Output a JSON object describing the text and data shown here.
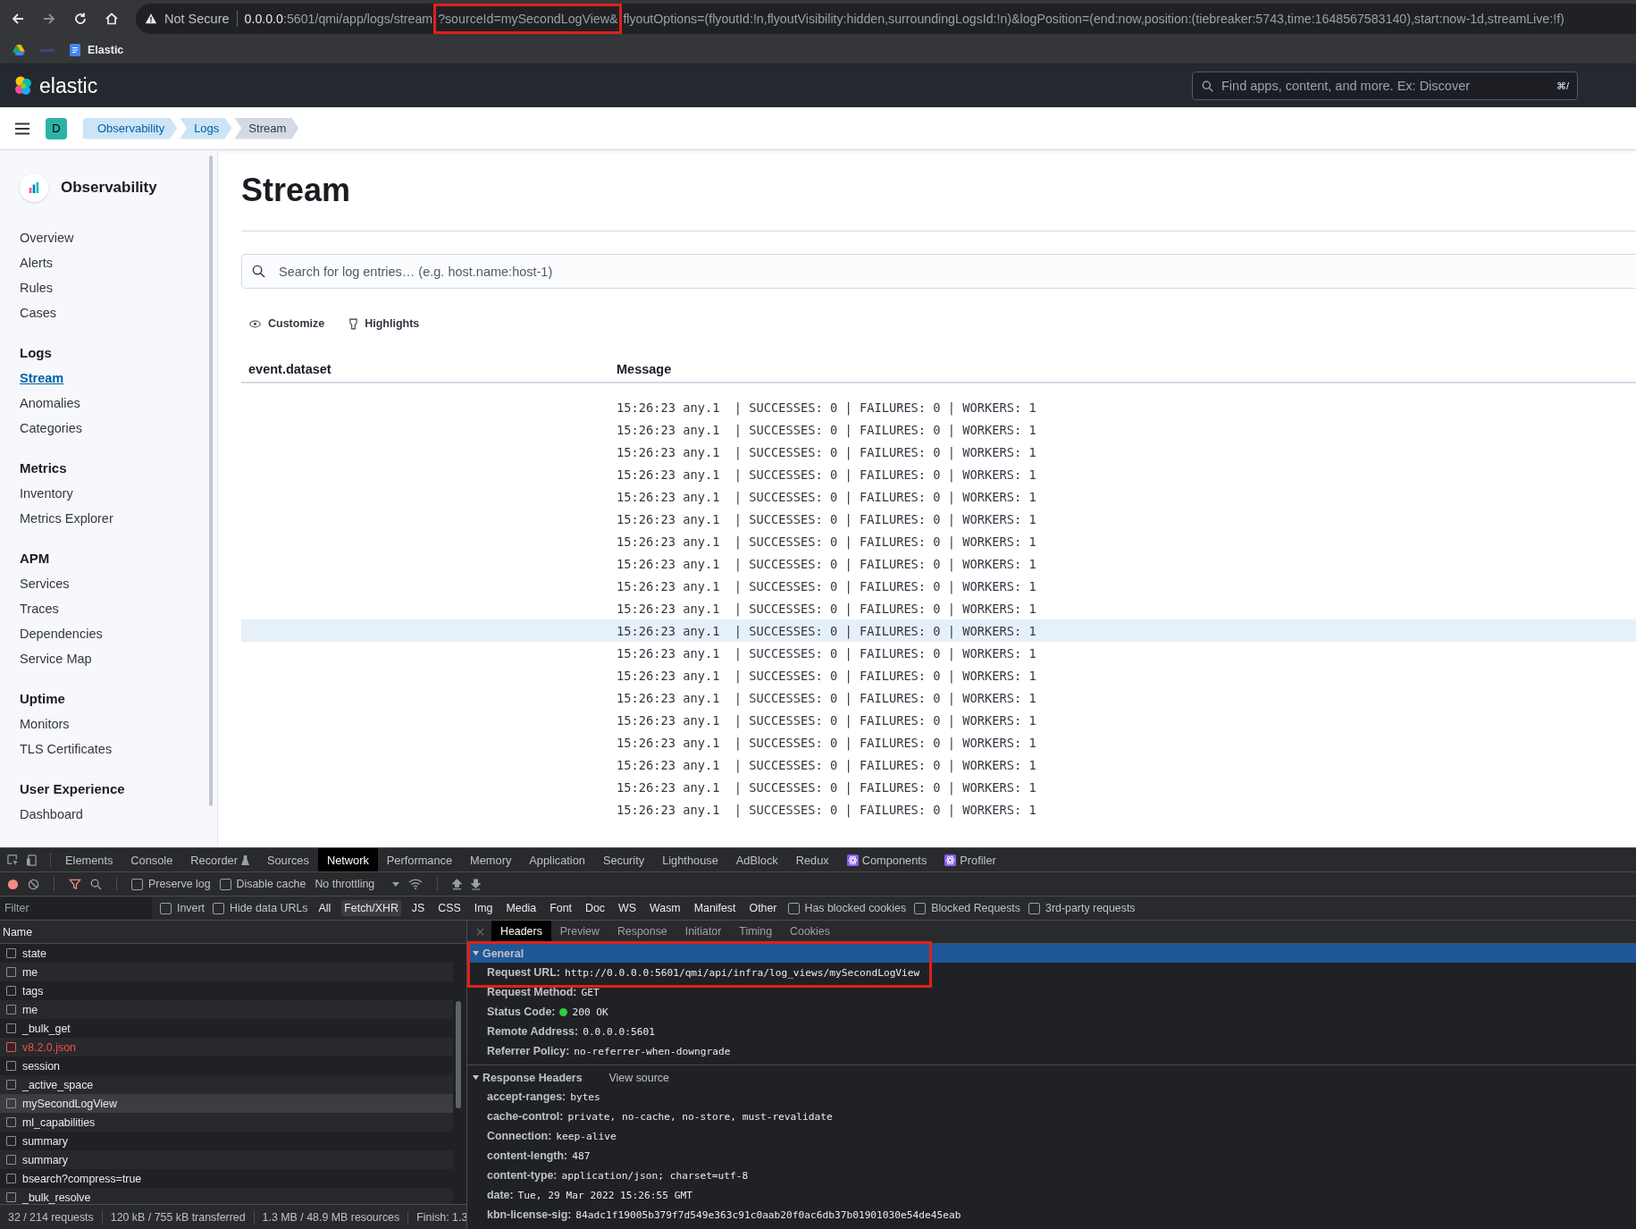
{
  "browser": {
    "security": "Not Secure",
    "url_segments": [
      {
        "text": "0.0.0.0",
        "kind": "host",
        "highlighted": false
      },
      {
        "text": ":5601/qmi/app/logs/stream",
        "kind": "path",
        "highlighted": false
      },
      {
        "text": "?sourceId=mySecondLogView&",
        "kind": "path",
        "highlighted": true
      },
      {
        "text": "flyoutOptions=(flyoutId:!n,flyoutVisibility:hidden,surroundingLogsId:!n)&logPosition=(end:now,position:(tiebreaker:5743,time:1648567583140),start:now-1d,streamLive:!f)",
        "kind": "path",
        "highlighted": false
      }
    ],
    "bookmarks": [
      {
        "kind": "drive"
      },
      {
        "kind": "faded"
      },
      {
        "kind": "doc",
        "label": "Elastic"
      }
    ]
  },
  "header": {
    "brand": "elastic",
    "search_placeholder": "Find apps, content, and more. Ex: Discover",
    "shortcut": "⌘/"
  },
  "breadcrumbs": {
    "avatar": "D",
    "items": [
      {
        "label": "Observability",
        "selected": false
      },
      {
        "label": "Logs",
        "selected": false
      },
      {
        "label": "Stream",
        "selected": true
      }
    ]
  },
  "sidebar": {
    "title": "Observability",
    "groups": [
      {
        "items": [
          {
            "label": "Overview",
            "selected": false
          },
          {
            "label": "Alerts",
            "selected": false
          },
          {
            "label": "Rules",
            "selected": false
          },
          {
            "label": "Cases",
            "selected": false
          }
        ]
      },
      {
        "heading": "Logs",
        "items": [
          {
            "label": "Stream",
            "selected": true
          },
          {
            "label": "Anomalies",
            "selected": false
          },
          {
            "label": "Categories",
            "selected": false
          }
        ]
      },
      {
        "heading": "Metrics",
        "items": [
          {
            "label": "Inventory",
            "selected": false
          },
          {
            "label": "Metrics Explorer",
            "selected": false
          }
        ]
      },
      {
        "heading": "APM",
        "items": [
          {
            "label": "Services",
            "selected": false
          },
          {
            "label": "Traces",
            "selected": false
          },
          {
            "label": "Dependencies",
            "selected": false
          },
          {
            "label": "Service Map",
            "selected": false
          }
        ]
      },
      {
        "heading": "Uptime",
        "items": [
          {
            "label": "Monitors",
            "selected": false
          },
          {
            "label": "TLS Certificates",
            "selected": false
          }
        ]
      },
      {
        "heading": "User Experience",
        "items": [
          {
            "label": "Dashboard",
            "selected": false
          }
        ]
      }
    ]
  },
  "page": {
    "title": "Stream",
    "search_placeholder": "Search for log entries… (e.g. host.name:host-1)",
    "controls": [
      {
        "label": "Customize",
        "kind": "eye"
      },
      {
        "label": "Highlights",
        "kind": "highlighter"
      }
    ],
    "columns": [
      "event.dataset",
      "Message"
    ],
    "rows": [
      {
        "message": "15:26:23 any.1  | SUCCESSES: 0 | FAILURES: 0 | WORKERS: 1",
        "selected": false
      },
      {
        "message": "15:26:23 any.1  | SUCCESSES: 0 | FAILURES: 0 | WORKERS: 1",
        "selected": false
      },
      {
        "message": "15:26:23 any.1  | SUCCESSES: 0 | FAILURES: 0 | WORKERS: 1",
        "selected": false
      },
      {
        "message": "15:26:23 any.1  | SUCCESSES: 0 | FAILURES: 0 | WORKERS: 1",
        "selected": false
      },
      {
        "message": "15:26:23 any.1  | SUCCESSES: 0 | FAILURES: 0 | WORKERS: 1",
        "selected": false
      },
      {
        "message": "15:26:23 any.1  | SUCCESSES: 0 | FAILURES: 0 | WORKERS: 1",
        "selected": false
      },
      {
        "message": "15:26:23 any.1  | SUCCESSES: 0 | FAILURES: 0 | WORKERS: 1",
        "selected": false
      },
      {
        "message": "15:26:23 any.1  | SUCCESSES: 0 | FAILURES: 0 | WORKERS: 1",
        "selected": false
      },
      {
        "message": "15:26:23 any.1  | SUCCESSES: 0 | FAILURES: 0 | WORKERS: 1",
        "selected": false
      },
      {
        "message": "15:26:23 any.1  | SUCCESSES: 0 | FAILURES: 0 | WORKERS: 1",
        "selected": false
      },
      {
        "message": "15:26:23 any.1  | SUCCESSES: 0 | FAILURES: 0 | WORKERS: 1",
        "selected": true
      },
      {
        "message": "15:26:23 any.1  | SUCCESSES: 0 | FAILURES: 0 | WORKERS: 1",
        "selected": false
      },
      {
        "message": "15:26:23 any.1  | SUCCESSES: 0 | FAILURES: 0 | WORKERS: 1",
        "selected": false
      },
      {
        "message": "15:26:23 any.1  | SUCCESSES: 0 | FAILURES: 0 | WORKERS: 1",
        "selected": false
      },
      {
        "message": "15:26:23 any.1  | SUCCESSES: 0 | FAILURES: 0 | WORKERS: 1",
        "selected": false
      },
      {
        "message": "15:26:23 any.1  | SUCCESSES: 0 | FAILURES: 0 | WORKERS: 1",
        "selected": false
      },
      {
        "message": "15:26:23 any.1  | SUCCESSES: 0 | FAILURES: 0 | WORKERS: 1",
        "selected": false
      },
      {
        "message": "15:26:23 any.1  | SUCCESSES: 0 | FAILURES: 0 | WORKERS: 1",
        "selected": false
      },
      {
        "message": "15:26:23 any.1  | SUCCESSES: 0 | FAILURES: 0 | WORKERS: 1",
        "selected": false
      }
    ]
  },
  "devtools": {
    "tabs": [
      {
        "label": "Elements",
        "selected": false
      },
      {
        "label": "Console",
        "selected": false
      },
      {
        "label": "Recorder",
        "selected": false,
        "kind": "flask"
      },
      {
        "label": "Sources",
        "selected": false
      },
      {
        "label": "Network",
        "selected": true
      },
      {
        "label": "Performance",
        "selected": false
      },
      {
        "label": "Memory",
        "selected": false
      },
      {
        "label": "Application",
        "selected": false
      },
      {
        "label": "Security",
        "selected": false
      },
      {
        "label": "Lighthouse",
        "selected": false
      },
      {
        "label": "AdBlock",
        "selected": false
      },
      {
        "label": "Redux",
        "selected": false
      },
      {
        "label": "Components",
        "selected": false,
        "kind": "react"
      },
      {
        "label": "Profiler",
        "selected": false,
        "kind": "react"
      }
    ],
    "toolbar": {
      "checks": [
        {
          "label": "Preserve log",
          "checked": false
        },
        {
          "label": "Disable cache",
          "checked": false
        }
      ],
      "throttling": "No throttling"
    },
    "filter": {
      "placeholder": "Filter",
      "checks": [
        {
          "label": "Invert",
          "checked": false
        },
        {
          "label": "Hide data URLs",
          "checked": false
        }
      ],
      "types": [
        {
          "label": "All",
          "selected": false
        },
        {
          "label": "Fetch/XHR",
          "selected": true
        },
        {
          "label": "JS",
          "selected": false
        },
        {
          "label": "CSS",
          "selected": false
        },
        {
          "label": "Img",
          "selected": false
        },
        {
          "label": "Media",
          "selected": false
        },
        {
          "label": "Font",
          "selected": false
        },
        {
          "label": "Doc",
          "selected": false
        },
        {
          "label": "WS",
          "selected": false
        },
        {
          "label": "Wasm",
          "selected": false
        },
        {
          "label": "Manifest",
          "selected": false
        },
        {
          "label": "Other",
          "selected": false
        }
      ],
      "more_checks": [
        {
          "label": "Has blocked cookies",
          "checked": false
        },
        {
          "label": "Blocked Requests",
          "checked": false
        },
        {
          "label": "3rd-party requests",
          "checked": false
        }
      ]
    },
    "requests_header": "Name",
    "requests": [
      {
        "name": "state",
        "error": false,
        "selected": false
      },
      {
        "name": "me",
        "error": false,
        "selected": false
      },
      {
        "name": "tags",
        "error": false,
        "selected": false
      },
      {
        "name": "me",
        "error": false,
        "selected": false
      },
      {
        "name": "_bulk_get",
        "error": false,
        "selected": false
      },
      {
        "name": "v8.2.0.json",
        "error": true,
        "selected": false
      },
      {
        "name": "session",
        "error": false,
        "selected": false
      },
      {
        "name": "_active_space",
        "error": false,
        "selected": false
      },
      {
        "name": "mySecondLogView",
        "error": false,
        "selected": true
      },
      {
        "name": "ml_capabilities",
        "error": false,
        "selected": false
      },
      {
        "name": "summary",
        "error": false,
        "selected": false
      },
      {
        "name": "summary",
        "error": false,
        "selected": false
      },
      {
        "name": "bsearch?compress=true",
        "error": false,
        "selected": false
      },
      {
        "name": "_bulk_resolve",
        "error": false,
        "selected": false
      }
    ],
    "status": [
      "32 / 214 requests",
      "120 kB / 755 kB transferred",
      "1.3 MB / 48.9 MB resources",
      "Finish: 1.3"
    ],
    "detail_tabs": [
      {
        "label": "Headers",
        "selected": true
      },
      {
        "label": "Preview",
        "selected": false
      },
      {
        "label": "Response",
        "selected": false
      },
      {
        "label": "Initiator",
        "selected": false
      },
      {
        "label": "Timing",
        "selected": false
      },
      {
        "label": "Cookies",
        "selected": false
      }
    ],
    "general": {
      "title": "General",
      "expanded": true,
      "highlighted": true,
      "rows": [
        {
          "key": "Request URL:",
          "value": "http://0.0.0.0:5601/qmi/api/infra/log_views/mySecondLogView"
        },
        {
          "key": "Request Method:",
          "value": "GET"
        },
        {
          "key": "Status Code:",
          "value": "200 OK",
          "color": "#2ecc40"
        },
        {
          "key": "Remote Address:",
          "value": "0.0.0.0:5601"
        },
        {
          "key": "Referrer Policy:",
          "value": "no-referrer-when-downgrade"
        }
      ]
    },
    "response_headers": {
      "title": "Response Headers",
      "expanded": true,
      "link": "View source",
      "rows": [
        {
          "key": "accept-ranges:",
          "value": "bytes"
        },
        {
          "key": "cache-control:",
          "value": "private, no-cache, no-store, must-revalidate"
        },
        {
          "key": "Connection:",
          "value": "keep-alive"
        },
        {
          "key": "content-length:",
          "value": "487"
        },
        {
          "key": "content-type:",
          "value": "application/json; charset=utf-8"
        },
        {
          "key": "date:",
          "value": "Tue, 29 Mar 2022 15:26:55 GMT"
        },
        {
          "key": "kbn-license-sig:",
          "value": "84adc1f19005b379f7d549e363c91c0aab20f0ac6db37b01901030e54de45eab"
        }
      ]
    }
  }
}
